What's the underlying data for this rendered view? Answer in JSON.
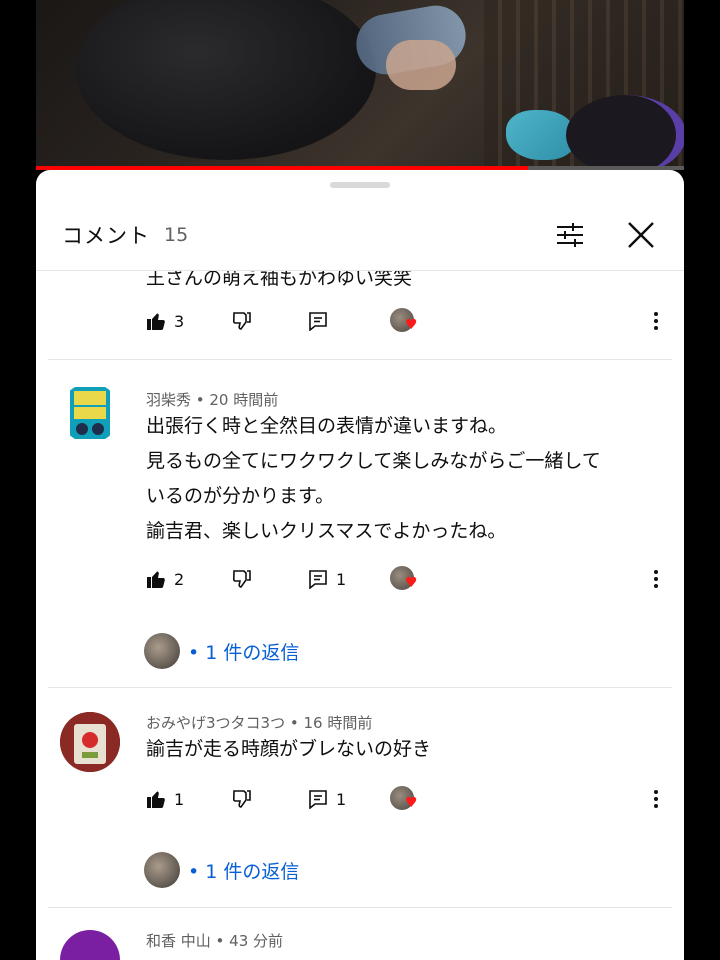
{
  "video": {
    "progress_fraction": 0.76
  },
  "header": {
    "title": "コメント",
    "count": "15"
  },
  "comments": [
    {
      "author": "",
      "time": "",
      "meta": "",
      "lines": [
        "王さんの萌え袖もかわゆい笑笑"
      ],
      "likes": "3",
      "replies_count": "",
      "reply_link": ""
    },
    {
      "author": "羽柴秀",
      "time": "20 時間前",
      "meta": "羽柴秀 • 20 時間前",
      "lines": [
        "出張行く時と全然目の表情が違いますね。",
        "見るもの全てにワクワクして楽しみながらご一緒して",
        "いるのが分かります。",
        "諭吉君、楽しいクリスマスでよかったね。"
      ],
      "likes": "2",
      "replies_count": "1",
      "reply_link": "• 1 件の返信"
    },
    {
      "author": "おみやげ3つタコ3つ",
      "time": "16 時間前",
      "meta": "おみやげ3つタコ3つ • 16 時間前",
      "lines": [
        "諭吉が走る時顔がブレないの好き"
      ],
      "likes": "1",
      "replies_count": "1",
      "reply_link": "• 1 件の返信"
    },
    {
      "author": "和香 中山",
      "time": "43 分前",
      "meta": "和香 中山 • 43 分前",
      "lines": [],
      "likes": "",
      "replies_count": "",
      "reply_link": ""
    }
  ],
  "colors": {
    "link": "#065fd4",
    "progress": "#ff0000",
    "heart": "#ff1a1a",
    "avatar_purple": "#7b1fa2"
  },
  "icons": [
    "thumbs-up-icon",
    "thumbs-down-icon",
    "reply-icon",
    "more-vert-icon",
    "filter-icon",
    "close-icon",
    "creator-heart-icon"
  ]
}
